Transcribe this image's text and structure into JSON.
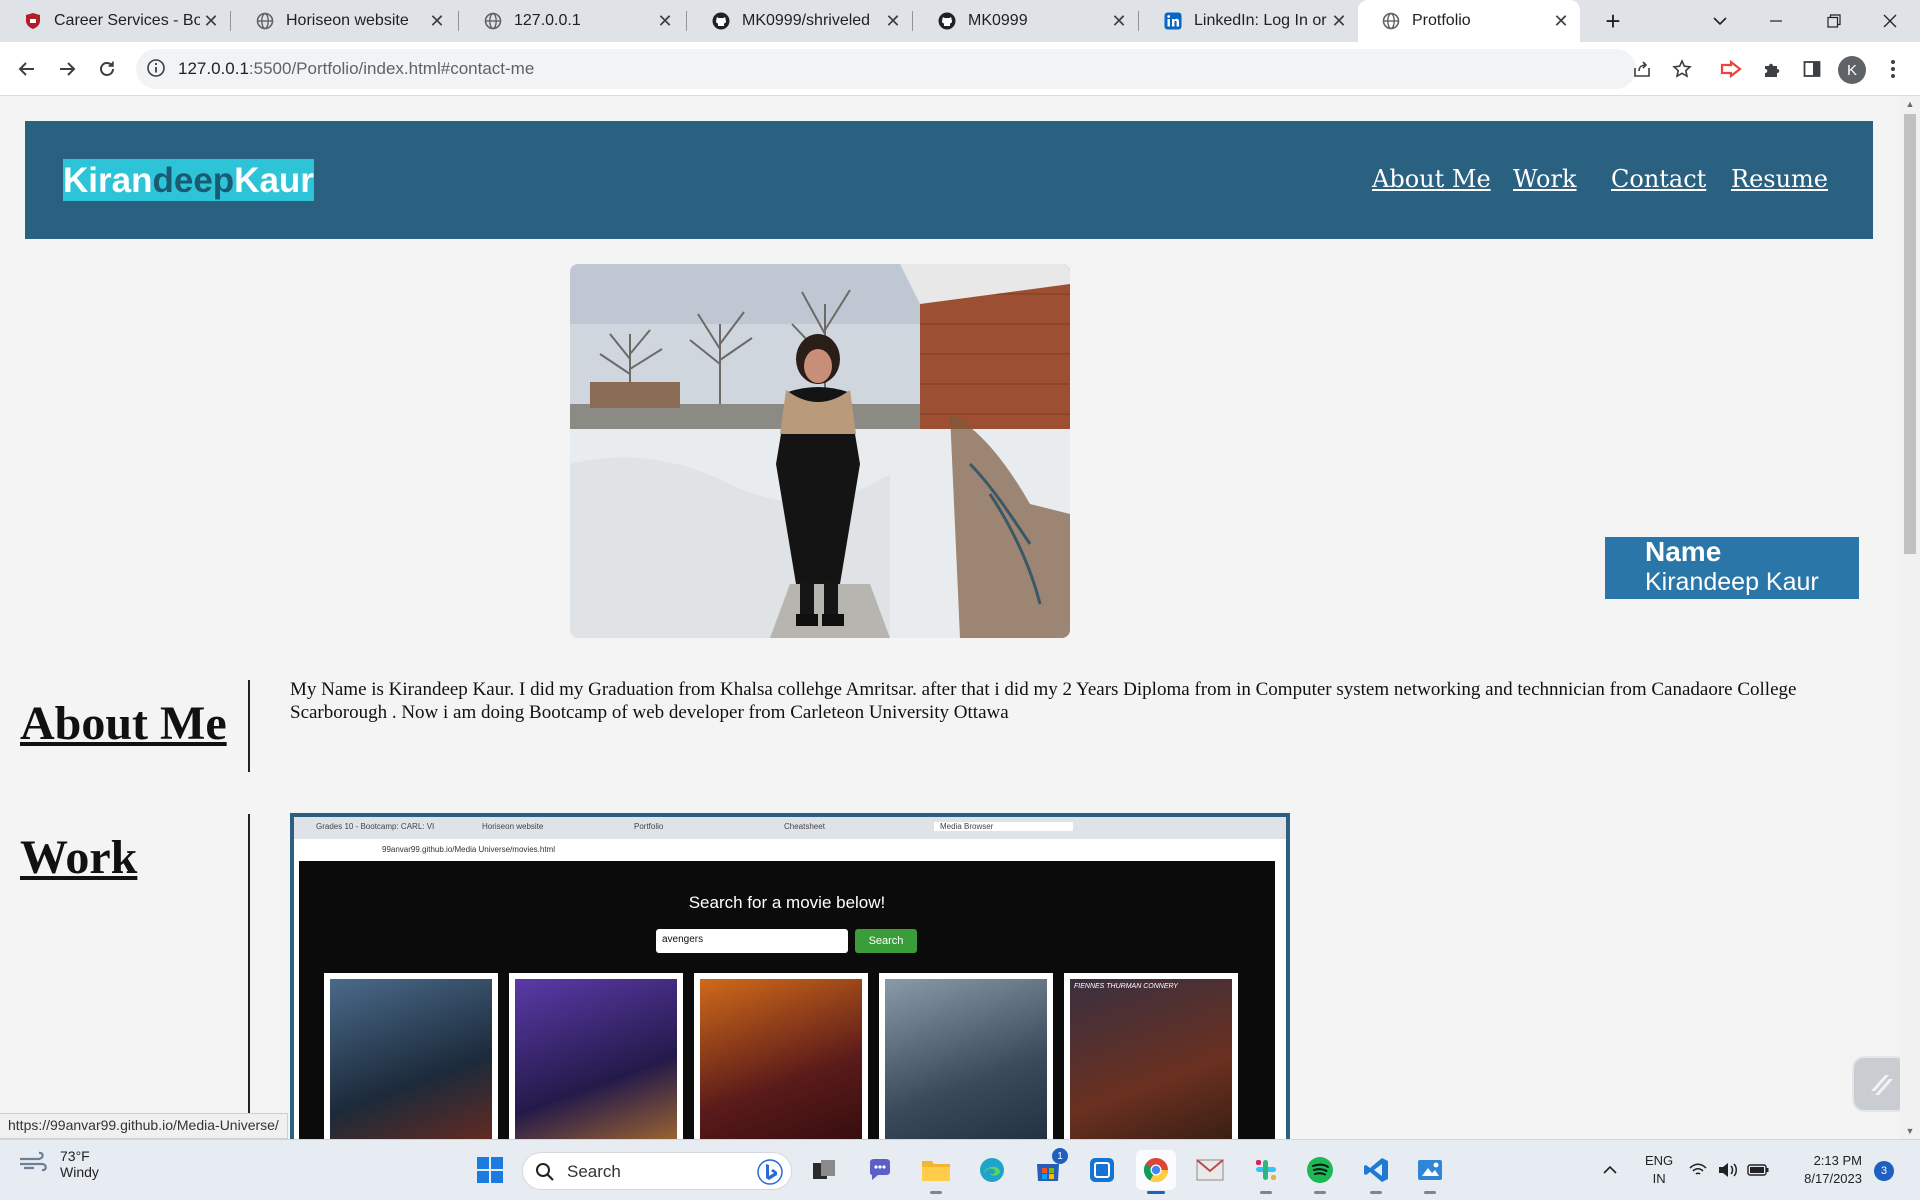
{
  "browser": {
    "tabs": [
      {
        "title": "Career Services - Boot",
        "icon": "bootcamp-shield-icon"
      },
      {
        "title": "Horiseon website",
        "icon": "globe-icon"
      },
      {
        "title": "127.0.0.1",
        "icon": "globe-icon"
      },
      {
        "title": "MK0999/shriveled",
        "icon": "github-icon"
      },
      {
        "title": "MK0999",
        "icon": "github-icon"
      },
      {
        "title": "LinkedIn: Log In or Si",
        "icon": "linkedin-icon"
      },
      {
        "title": "Protfolio",
        "icon": "globe-icon",
        "active": true
      }
    ],
    "url_host": "127.0.0.1",
    "url_rest": ":5500/Portfolio/index.html#contact-me",
    "profile_initial": "K",
    "status_url": "https://99anvar99.github.io/Media-Universe/"
  },
  "site": {
    "logo": {
      "part1": "Kiran",
      "part2": "deep",
      "part3": "Kaur"
    },
    "nav": [
      "About Me",
      "Work",
      "Contact",
      "Resume"
    ],
    "namebox": {
      "label": "Name",
      "value": "Kirandeep Kaur"
    },
    "about": {
      "title": "About Me",
      "text": "My Name is Kirandeep Kaur. I did my Graduation from Khalsa collehge Amritsar. after that i did my 2 Years Diploma from in Computer system networking and technnician from Canadaore College Scarborough . Now i am doing Bootcamp of web developer from Carleteon University Ottawa"
    },
    "work": {
      "title": "Work",
      "screenshot": {
        "tabs": [
          "Grades 10 - Bootcamp: CARL: VI",
          "Horiseon website",
          "Portfolio",
          "Cheatsheet",
          "Media Browser"
        ],
        "url": "99anvar99.github.io/Media Universe/movies.html",
        "heading": "Search for a movie below!",
        "input_value": "avengers",
        "search_label": "Search",
        "poster_top_text": "FIENNES  THURMAN  CONNERY"
      }
    }
  },
  "taskbar": {
    "temp": "73°F",
    "condition": "Windy",
    "search_label": "Search",
    "lang_line1": "ENG",
    "lang_line2": "IN",
    "time": "2:13 PM",
    "date": "8/17/2023",
    "notifications": "3",
    "store_badge": "1"
  },
  "colors": {
    "header_bg": "#2a6180",
    "logo_bg": "#2ec4d7",
    "namebox_bg": "#2a76a8",
    "accent_green": "#3a9d3a"
  }
}
